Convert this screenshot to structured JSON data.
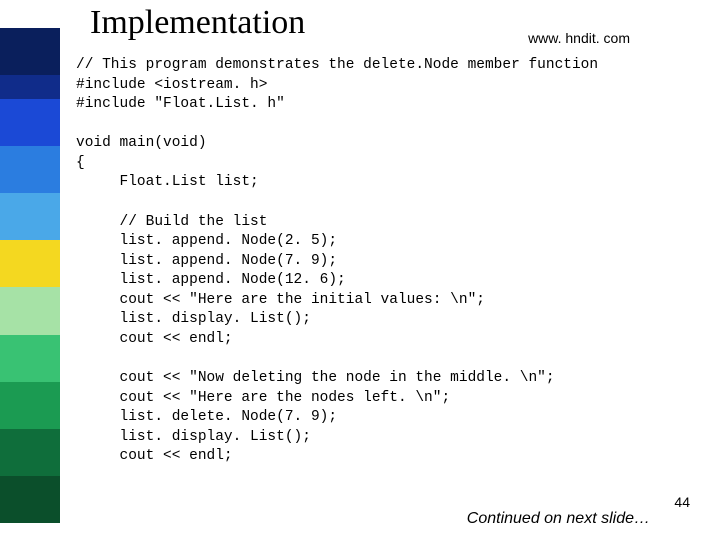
{
  "sidebar_colors": [
    "#0a1f5c",
    "#0a1f5c",
    "#102c8a",
    "#1b49d6",
    "#1b49d6",
    "#2b7de0",
    "#2b7de0",
    "#4aa8e8",
    "#4aa8e8",
    "#f4d820",
    "#f4d820",
    "#a6e2a6",
    "#a6e2a6",
    "#39c273",
    "#39c273",
    "#1b9b52",
    "#1b9b52",
    "#0f6e3b",
    "#0f6e3b",
    "#0b4f2b",
    "#0b4f2b"
  ],
  "heading": "Implementation",
  "url": "www. hndit. com",
  "code_lines": [
    "// This program demonstrates the delete.Node member function",
    "#include <iostream. h>",
    "#include \"Float.List. h\"",
    "",
    "void main(void)",
    "{",
    "     Float.List list;",
    "",
    "     // Build the list",
    "     list. append. Node(2. 5);",
    "     list. append. Node(7. 9);",
    "     list. append. Node(12. 6);",
    "     cout << \"Here are the initial values: \\n\";",
    "     list. display. List();",
    "     cout << endl;",
    "",
    "     cout << \"Now deleting the node in the middle. \\n\";",
    "     cout << \"Here are the nodes left. \\n\";",
    "     list. delete. Node(7. 9);",
    "     list. display. List();",
    "     cout << endl;"
  ],
  "continued": "Continued on next slide…",
  "pagenum": "44"
}
